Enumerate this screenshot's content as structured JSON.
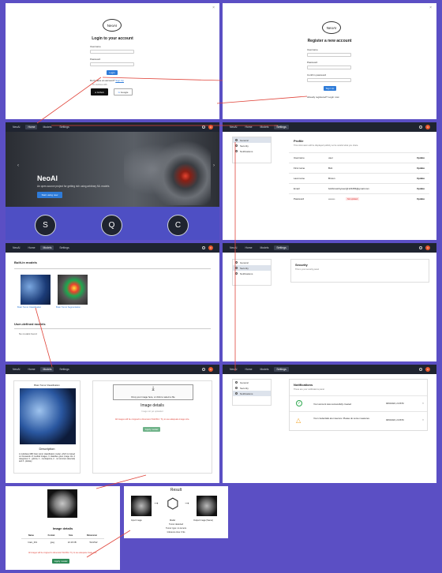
{
  "login": {
    "logo": "NeoAI",
    "title": "Login to your account",
    "username_label": "Username",
    "password_label": "Password",
    "login_button": "Login",
    "no_account": "Don't have an account?",
    "signup_link": "Sign Up",
    "or_continue": "Or continue with",
    "github_button": "Github",
    "google_button": "Google"
  },
  "register": {
    "logo": "NeoAI",
    "title": "Register a new account",
    "username_label": "Username",
    "password_label": "Password",
    "confirm_label": "Confirm password",
    "signup_button": "Sign Up",
    "already": "Already registered? Login now"
  },
  "nav": {
    "brand": "NeoAI",
    "tabs": [
      "Home",
      "Models",
      "Settings"
    ],
    "avatar": "U"
  },
  "hero": {
    "title": "NeoAI",
    "subtitle": "An open-source project for getting rich using arbitrary ML models",
    "cta": "Start using now",
    "circles": [
      "S",
      "Q",
      "C"
    ]
  },
  "settings": {
    "menu": [
      "General",
      "Security",
      "Notifications"
    ]
  },
  "profile": {
    "title": "Profile",
    "desc": "This information will be displayed publicly so be careful what you share.",
    "update": "Update",
    "fields": [
      {
        "label": "Username",
        "value": "user"
      },
      {
        "label": "First name",
        "value": "Bob"
      },
      {
        "label": "Last name",
        "value": "Brown"
      },
      {
        "label": "Email",
        "value": "bobbrownbyuser@123456@gmail.com"
      },
      {
        "label": "Password",
        "value": "••••••••",
        "extra": "Not updated"
      }
    ]
  },
  "models": {
    "builtin_title": "Built-in models",
    "model1": "Brain Tumor Classification",
    "model2": "Brain Tumor Segmentation",
    "user_title": "User-defined models",
    "none": "No models found"
  },
  "security": {
    "title": "Security",
    "desc": "This is your security panel"
  },
  "notifications": {
    "title": "Notifications",
    "desc": "These are your notifications panel",
    "items": [
      {
        "text": "Your account was successfully created",
        "date": "08/04/2024, 21:08:53"
      },
      {
        "text": "Your credentials are insecure. Please do some measures.",
        "date": "08/04/2024, 21:08:53"
      }
    ]
  },
  "classification": {
    "model_title": "Brain Tumor Classification",
    "desc_title": "Description",
    "desc": "A multiclass MRI brain tumor classification model, which is trained on thousands of medical images. It classifies given image into 4 categories: 0 - glioma, 1 - meningioma, 2 - no tumor(no detected) and 3 - pituitary.",
    "upload": "Drop your image here, or click to select a file",
    "details_title": "Image details",
    "no_image": "Image not yet uploaded",
    "warning": "All images will be cropped to dimension 512x512. Try to use adequate image size.",
    "apply": "Apply model"
  },
  "image_details": {
    "title": "Image details",
    "headers": [
      "Name",
      "Format",
      "Size",
      "Dimension"
    ],
    "values": [
      "brain_001",
      "jpeg",
      "22.16 KB",
      "512x512"
    ],
    "warning": "All images will be cropped to dimension 512x512. Try to use adequate image size.",
    "apply": "Apply model"
  },
  "result": {
    "title": "Result",
    "input": "Input Image",
    "model": "Model",
    "output": "Output Image (Same)",
    "detect": "Tumor detected",
    "type": "Tumor type: no tumors",
    "time": "Inference time: 0.9s"
  }
}
